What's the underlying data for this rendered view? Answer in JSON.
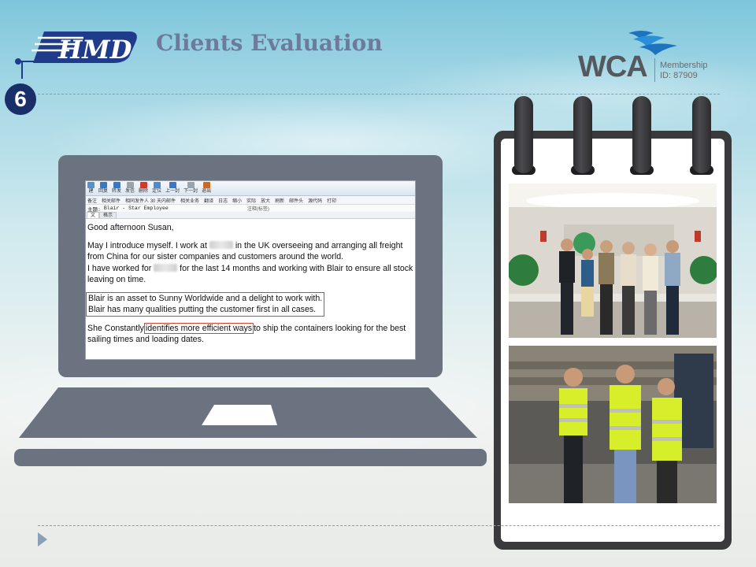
{
  "header": {
    "title": "Clients Evaluation",
    "step_number": "6",
    "logo_text": "HMD",
    "wca": {
      "logo_text": "WCA",
      "membership_label": "Membership",
      "membership_id": "ID: 87909"
    }
  },
  "email": {
    "toolbar_main": [
      "建",
      "回复",
      "转发",
      "发信",
      "删除",
      "定位",
      "上一封",
      "下一封",
      "退出"
    ],
    "toolbar_secondary": [
      "备注",
      "相关邮件",
      "相同发件人 30 天内邮件",
      "相关业务",
      "翻译",
      "日志",
      "缩小",
      "实际",
      "放大",
      "刷新",
      "邮件头",
      "源代码",
      "打印"
    ],
    "subject_label": "主题:",
    "subject": "Blair - Star Employee",
    "subject_note": "注释(标签)",
    "tabs": [
      "文",
      "格示"
    ],
    "greeting": "Good afternoon Susan,",
    "para1_a": "May I introduce myself.  I work at",
    "para1_b": "in the UK overseeing and arranging all freight",
    "para1_c": "from China for our sister companies and customers around the world.",
    "para1_d": "I have worked for",
    "para1_e": "for the last 14 months and working with Blair to ensure all stock is",
    "para1_f": "leaving on time.",
    "para2_a": "Blair is an asset to Sunny Worldwide and a delight to work with.",
    "para2_b": "Blair has many qualities putting the customer first in all cases.",
    "para3_a": "She Constantly",
    "para3_highlight": "identifies more efficient ways",
    "para3_b": "to ship the containers looking for the best",
    "para3_c": "sailing times and loading dates."
  },
  "colors": {
    "title": "#6d7a9a",
    "laptop": "#6b7280",
    "badge": "#1a2f6a",
    "highlight_border": "#d0453a"
  }
}
